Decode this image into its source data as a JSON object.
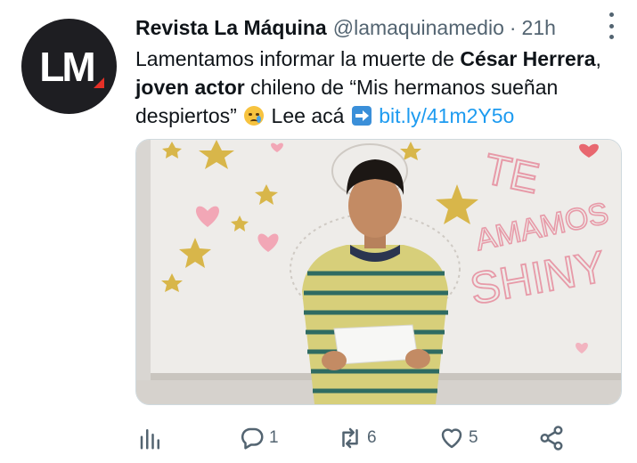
{
  "tweet": {
    "avatar_text": "LM",
    "display_name": "Revista La Máquina",
    "handle": "@lamaquinamedio",
    "separator": "·",
    "time": "21h",
    "text": {
      "p1": "Lamentamos informar la muerte de ",
      "b1": "César Herrera",
      "p2": ", ",
      "b2": "joven actor",
      "p3": " chileno de “Mis hermanos sueñan despiertos” ",
      "p4": " Lee acá ",
      "link": "bit.ly/41m2Y5o"
    },
    "media": {
      "board_text_1": "TE",
      "board_text_2": "AMAMOS",
      "board_text_3": "SHINY"
    },
    "actions": {
      "analytics_icon": "bar-chart-icon",
      "replies": "1",
      "retweets": "6",
      "likes": "5",
      "share_icon": "share-icon"
    }
  },
  "colors": {
    "link": "#1d9bf0",
    "secondary": "#536471",
    "avatar_bg": "#1e1e22",
    "avatar_accent": "#e63027"
  }
}
